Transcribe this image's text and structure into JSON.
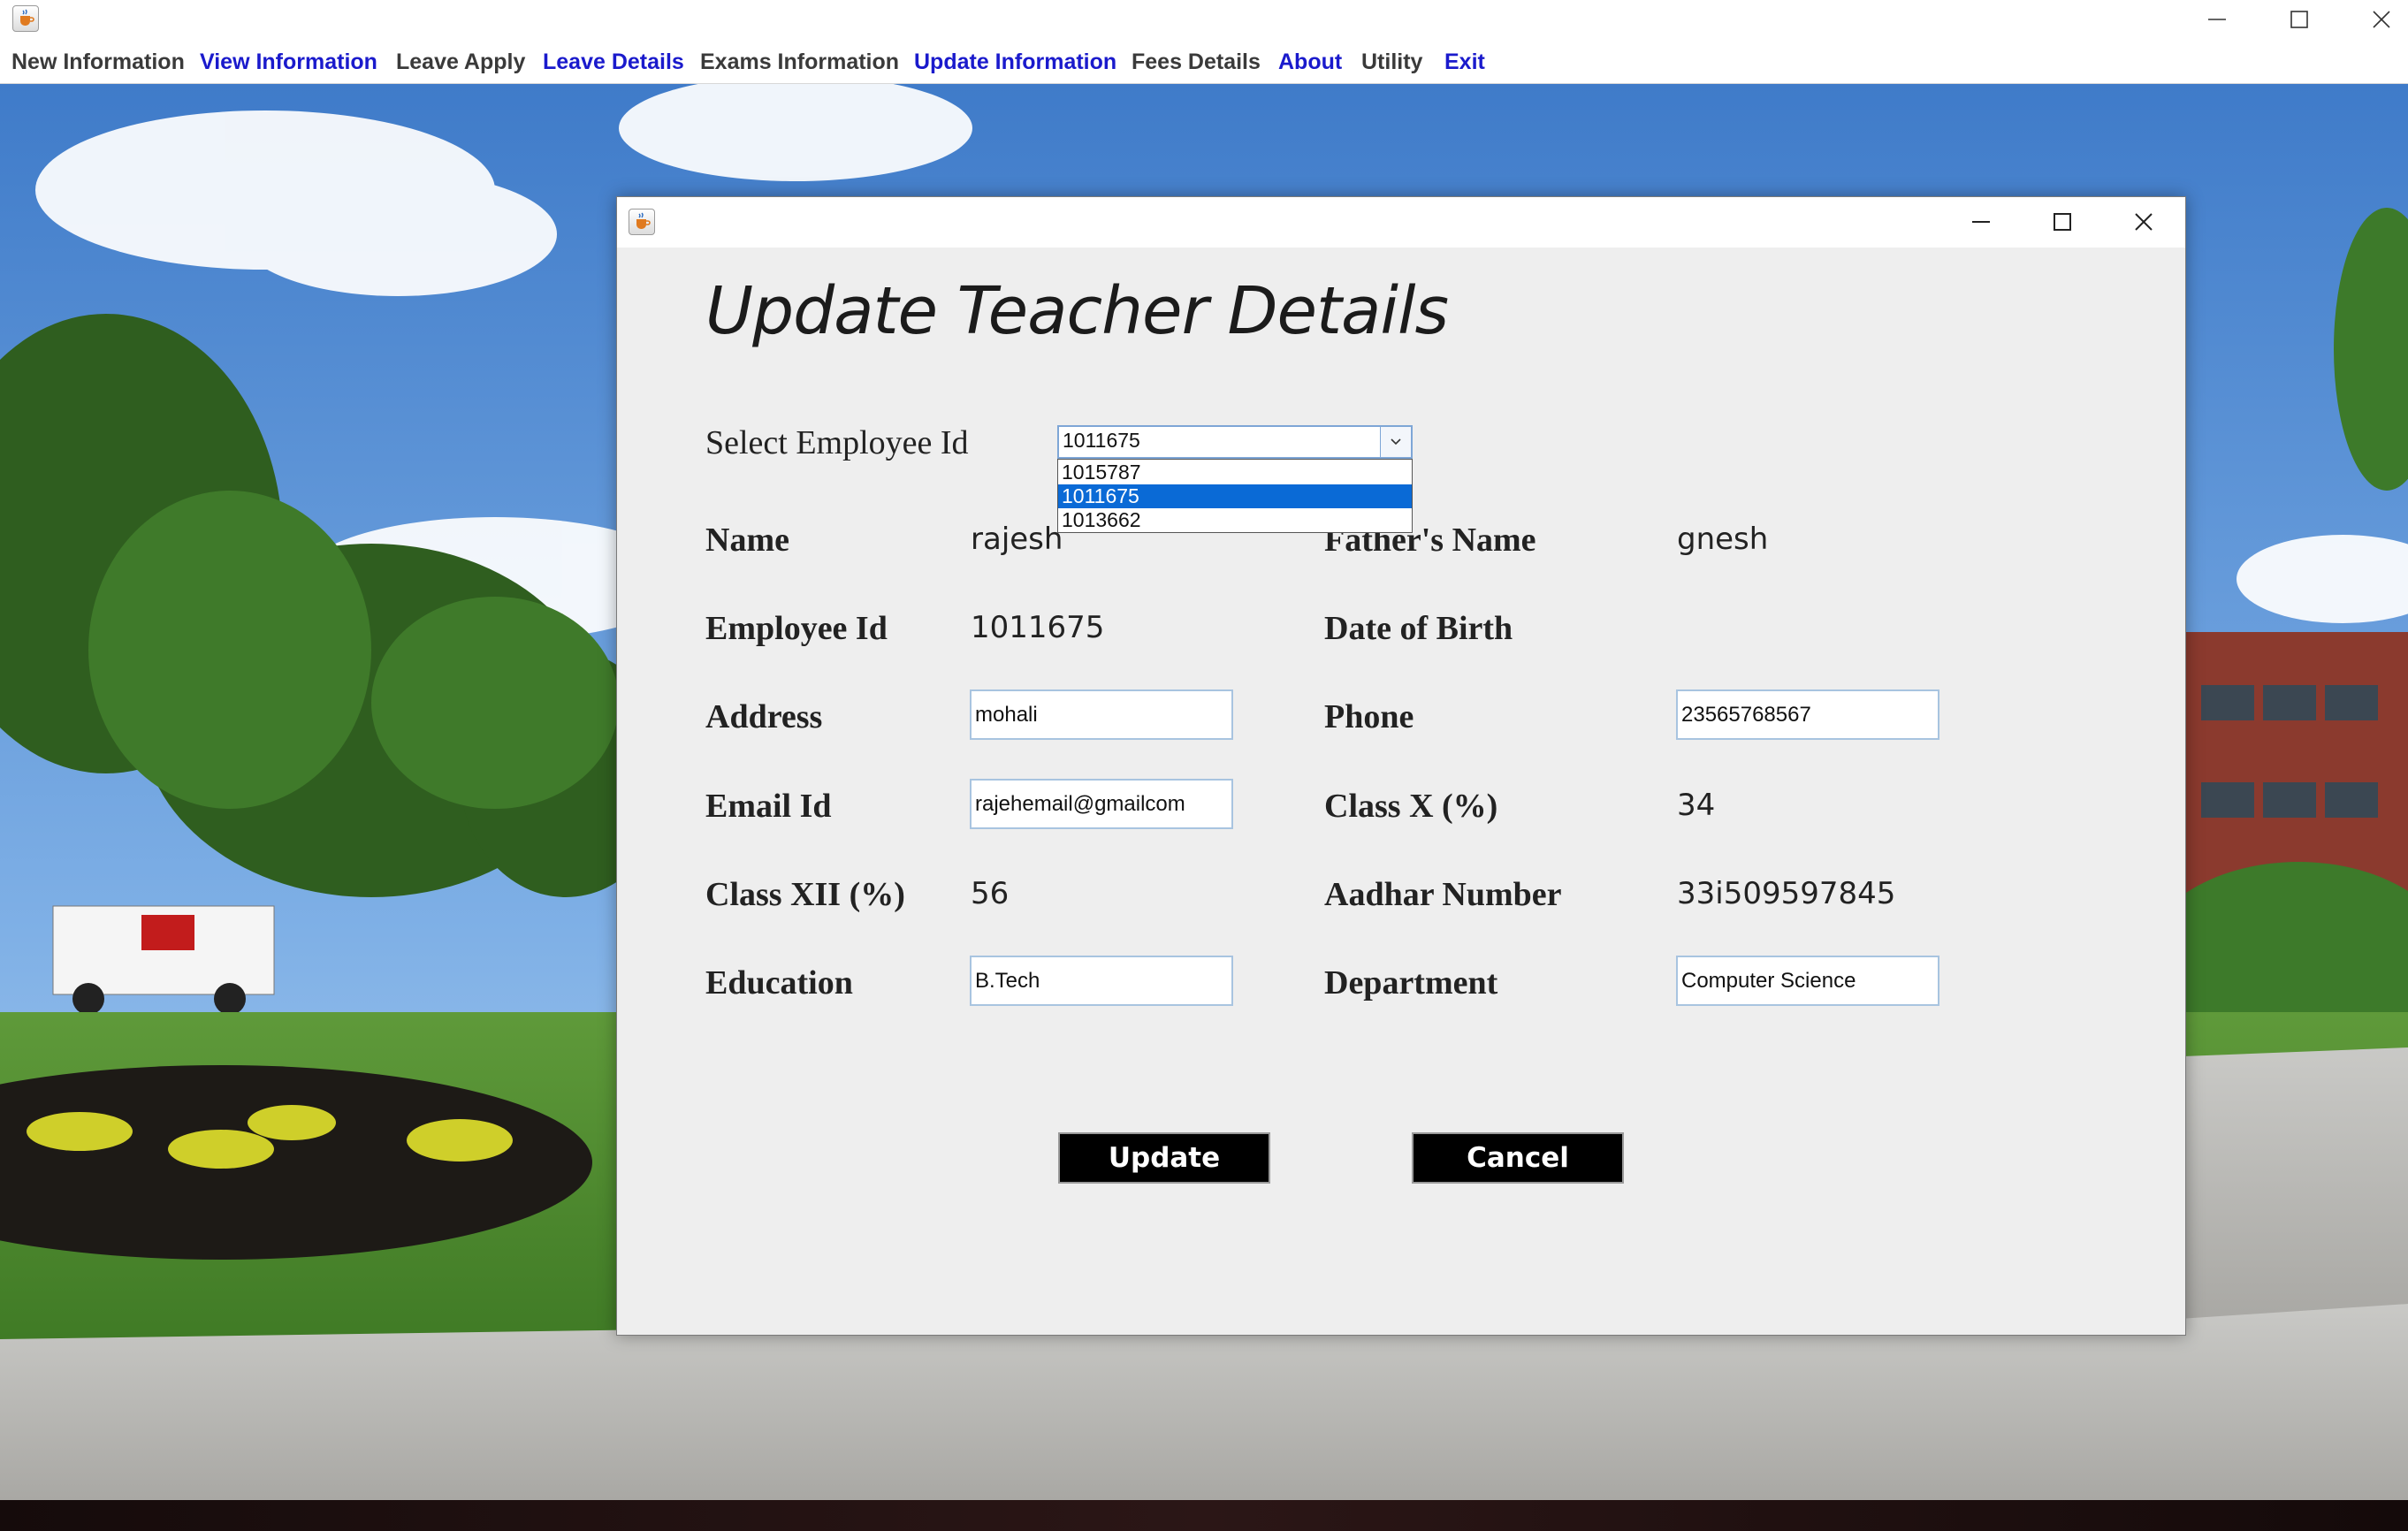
{
  "window": {
    "icon": "java-coffee-icon"
  },
  "menu": {
    "items": [
      {
        "label": "New Information"
      },
      {
        "label": "View Information"
      },
      {
        "label": "Leave Apply"
      },
      {
        "label": "Leave Details"
      },
      {
        "label": "Exams Information"
      },
      {
        "label": "Update Information"
      },
      {
        "label": "Fees Details"
      },
      {
        "label": "About"
      },
      {
        "label": "Utility"
      },
      {
        "label": "Exit"
      }
    ],
    "colors": {
      "dark": "#3a3a3a",
      "blue": "#1a1acc"
    }
  },
  "dialog": {
    "heading": "Update Teacher Details",
    "select_label": "Select Employee Id",
    "employee_combo": {
      "selected": "1011675",
      "options": [
        "1015787",
        "1011675",
        "1013662"
      ],
      "highlighted": "1011675"
    },
    "fields": {
      "name": {
        "label": "Name",
        "value": "rajesh"
      },
      "fathers_name": {
        "label": "Father's Name",
        "value": "gnesh"
      },
      "employee_id": {
        "label": "Employee Id",
        "value": "1011675"
      },
      "dob": {
        "label": "Date of Birth",
        "value": ""
      },
      "address": {
        "label": "Address",
        "value": "mohali"
      },
      "phone": {
        "label": "Phone",
        "value": "23565768567"
      },
      "email": {
        "label": "Email Id",
        "value": "rajehemail@gmailcom"
      },
      "class_x": {
        "label": "Class X (%)",
        "value": "34"
      },
      "class_xii": {
        "label": "Class XII (%)",
        "value": "56"
      },
      "aadhar": {
        "label": "Aadhar Number",
        "value": "33i509597845"
      },
      "education": {
        "label": "Education",
        "value": "B.Tech"
      },
      "department": {
        "label": "Department",
        "value": "Computer Science"
      }
    },
    "buttons": {
      "update": "Update",
      "cancel": "Cancel"
    }
  },
  "colors": {
    "selection": "#0a6ad6",
    "field_border": "#a8c4e0",
    "dialog_bg": "#eeeeee"
  }
}
